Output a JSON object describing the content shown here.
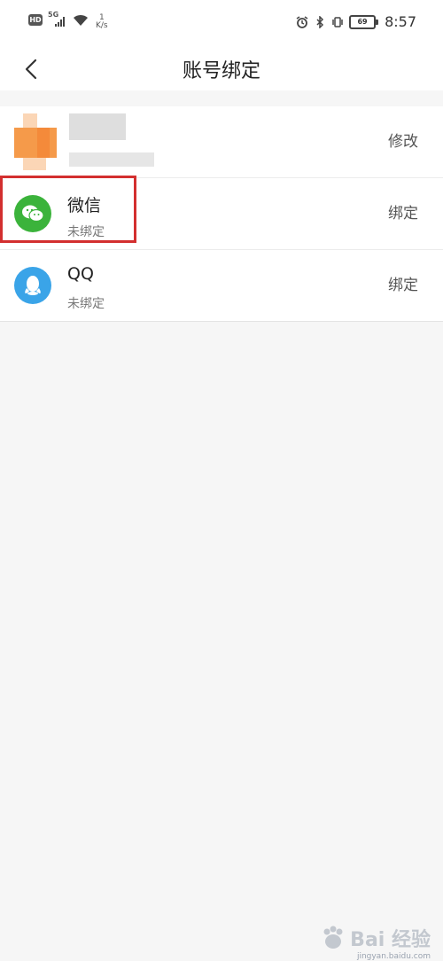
{
  "status_bar": {
    "hd": "HD",
    "network": "5G",
    "speed_value": "1",
    "speed_unit": "K/s",
    "battery": "69",
    "time": "8:57"
  },
  "header": {
    "title": "账号绑定"
  },
  "accounts": [
    {
      "title": "",
      "subtitle": "",
      "action": "修改"
    },
    {
      "title": "微信",
      "subtitle": "未绑定",
      "action": "绑定"
    },
    {
      "title": "QQ",
      "subtitle": "未绑定",
      "action": "绑定"
    }
  ],
  "colors": {
    "wechat": "#3bb33b",
    "qq": "#3aa4e8",
    "highlight": "#d32f2f",
    "avatar": "#f59a4a"
  },
  "watermark": {
    "text": "Bai 经验",
    "url": "jingyan.baidu.com"
  }
}
